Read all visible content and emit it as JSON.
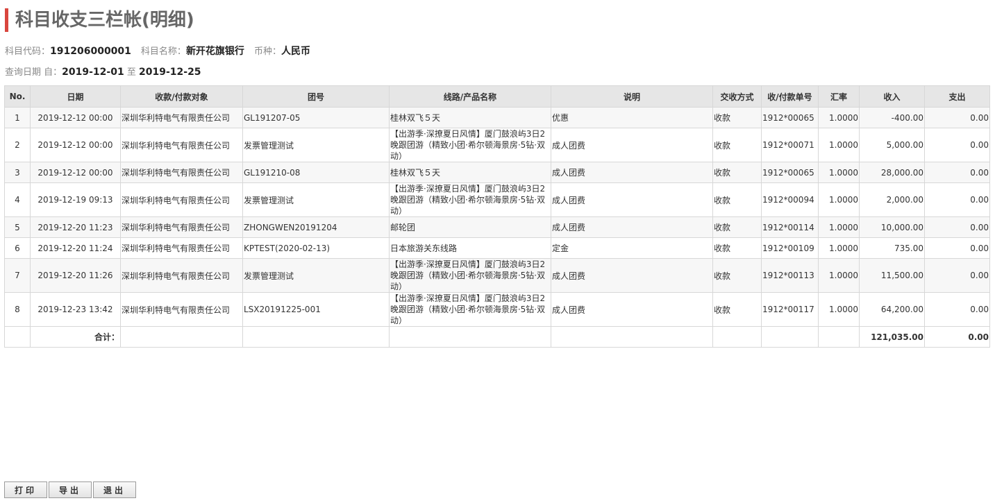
{
  "title": "科目收支三栏帐(明细)",
  "info": {
    "code_label": "科目代码：",
    "code": "191206000001",
    "name_label": "科目名称：",
    "name": "新开花旗银行",
    "currency_label": "币种：",
    "currency": "人民币",
    "date_label": "查询日期 自：",
    "date_from": "2019-12-01",
    "date_to_label": "至",
    "date_to": "2019-12-25"
  },
  "table": {
    "headers": [
      "No.",
      "日期",
      "收款/付款对象",
      "团号",
      "线路/产品名称",
      "说明",
      "交收方式",
      "收/付款单号",
      "汇率",
      "收入",
      "支出"
    ],
    "rows": [
      {
        "no": "1",
        "date": "2019-12-12 00:00",
        "party": "深圳华利特电气有限责任公司",
        "group": "GL191207-05",
        "route": "桂林双飞５天",
        "desc": "优惠",
        "method": "收款",
        "voucher": "1912*00065",
        "rate": "1.0000",
        "income": "-400.00",
        "expense": "0.00"
      },
      {
        "no": "2",
        "date": "2019-12-12 00:00",
        "party": "深圳华利特电气有限责任公司",
        "group": "发票管理测试",
        "route": "【出游季·深撩夏日风情】厦门鼓浪屿3日2晚跟团游（精致小团·希尔顿海景房·5钻·双动）",
        "desc": "成人团费",
        "method": "收款",
        "voucher": "1912*00071",
        "rate": "1.0000",
        "income": "5,000.00",
        "expense": "0.00"
      },
      {
        "no": "3",
        "date": "2019-12-12 00:00",
        "party": "深圳华利特电气有限责任公司",
        "group": "GL191210-08",
        "route": "桂林双飞５天",
        "desc": "成人团费",
        "method": "收款",
        "voucher": "1912*00065",
        "rate": "1.0000",
        "income": "28,000.00",
        "expense": "0.00"
      },
      {
        "no": "4",
        "date": "2019-12-19 09:13",
        "party": "深圳华利特电气有限责任公司",
        "group": "发票管理测试",
        "route": "【出游季·深撩夏日风情】厦门鼓浪屿3日2晚跟团游（精致小团·希尔顿海景房·5钻·双动）",
        "desc": "成人团费",
        "method": "收款",
        "voucher": "1912*00094",
        "rate": "1.0000",
        "income": "2,000.00",
        "expense": "0.00"
      },
      {
        "no": "5",
        "date": "2019-12-20 11:23",
        "party": "深圳华利特电气有限责任公司",
        "group": "ZHONGWEN20191204",
        "route": "邮轮团",
        "desc": "成人团费",
        "method": "收款",
        "voucher": "1912*00114",
        "rate": "1.0000",
        "income": "10,000.00",
        "expense": "0.00"
      },
      {
        "no": "6",
        "date": "2019-12-20 11:24",
        "party": "深圳华利特电气有限责任公司",
        "group": "KPTEST(2020-02-13)",
        "route": "日本旅游关东线路",
        "desc": "定金",
        "method": "收款",
        "voucher": "1912*00109",
        "rate": "1.0000",
        "income": "735.00",
        "expense": "0.00"
      },
      {
        "no": "7",
        "date": "2019-12-20 11:26",
        "party": "深圳华利特电气有限责任公司",
        "group": "发票管理测试",
        "route": "【出游季·深撩夏日风情】厦门鼓浪屿3日2晚跟团游（精致小团·希尔顿海景房·5钻·双动）",
        "desc": "成人团费",
        "method": "收款",
        "voucher": "1912*00113",
        "rate": "1.0000",
        "income": "11,500.00",
        "expense": "0.00"
      },
      {
        "no": "8",
        "date": "2019-12-23 13:42",
        "party": "深圳华利特电气有限责任公司",
        "group": "LSX20191225-001",
        "route": "【出游季·深撩夏日风情】厦门鼓浪屿3日2晚跟团游（精致小团·希尔顿海景房·5钻·双动）",
        "desc": "成人团费",
        "method": "收款",
        "voucher": "1912*00117",
        "rate": "1.0000",
        "income": "64,200.00",
        "expense": "0.00"
      }
    ],
    "total_label": "合计：",
    "total_income": "121,035.00",
    "total_expense": "0.00"
  },
  "buttons": {
    "print": "打印",
    "export": "导出",
    "exit": "退出"
  }
}
